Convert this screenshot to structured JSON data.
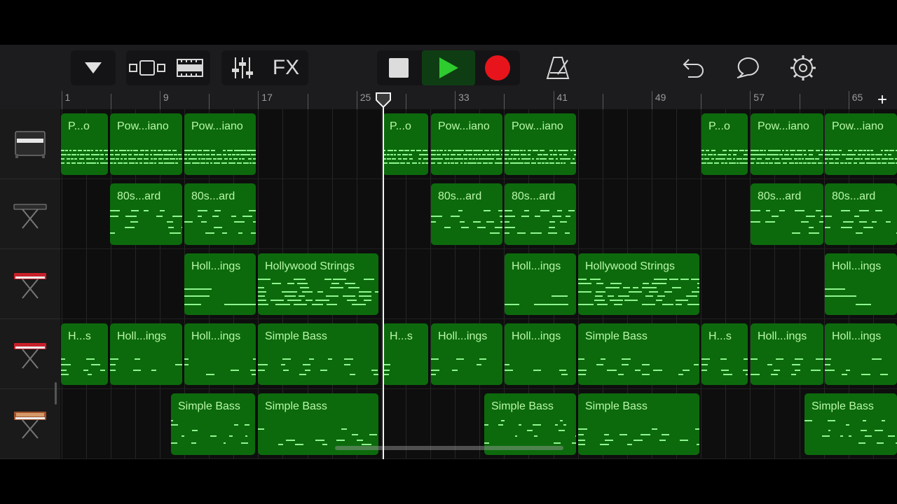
{
  "toolbar": {
    "fx_label": "FX"
  },
  "ruler": {
    "bars": [
      "1",
      "9",
      "17",
      "25",
      "33",
      "41",
      "49",
      "57",
      "65"
    ],
    "add_label": "+"
  },
  "tracks": [
    {
      "instrument": "piano-icon",
      "regions": [
        {
          "name": "P...o",
          "style": "dense"
        },
        {
          "name": "Pow...iano",
          "style": "dense"
        },
        {
          "name": "Pow...iano",
          "style": "dense"
        },
        {
          "name": "P...o",
          "style": "dense"
        },
        {
          "name": "Pow...iano",
          "style": "dense"
        },
        {
          "name": "Pow...iano",
          "style": "dense"
        },
        {
          "name": "P...o",
          "style": "dense"
        },
        {
          "name": "Pow...iano",
          "style": "dense"
        },
        {
          "name": "Pow...iano",
          "style": "dense"
        }
      ]
    },
    {
      "instrument": "keyboard-stand-icon",
      "regions": [
        {
          "name": "80s...ard",
          "style": "keys"
        },
        {
          "name": "80s...ard",
          "style": "keys"
        },
        {
          "name": "80s...ard",
          "style": "keys"
        },
        {
          "name": "80s...ard",
          "style": "keys"
        },
        {
          "name": "80s...ard",
          "style": "keys"
        },
        {
          "name": "80s...ard",
          "style": "keys"
        }
      ]
    },
    {
      "instrument": "red-synth-icon",
      "regions": [
        {
          "name": "Holl...ings",
          "style": "strings-sparse"
        },
        {
          "name": "Hollywood Strings",
          "style": "strings"
        },
        {
          "name": "Holl...ings",
          "style": "strings-sparse"
        },
        {
          "name": "Hollywood Strings",
          "style": "strings"
        },
        {
          "name": "Holl...ings",
          "style": "strings-sparse"
        }
      ]
    },
    {
      "instrument": "red-synth-icon",
      "regions": [
        {
          "name": "H...s",
          "style": "bass"
        },
        {
          "name": "Holl...ings",
          "style": "bass"
        },
        {
          "name": "Holl...ings",
          "style": "bass"
        },
        {
          "name": "Simple Bass",
          "style": "bass"
        },
        {
          "name": "H...s",
          "style": "bass"
        },
        {
          "name": "Holl...ings",
          "style": "bass"
        },
        {
          "name": "Holl...ings",
          "style": "bass"
        },
        {
          "name": "Simple Bass",
          "style": "bass"
        },
        {
          "name": "H...s",
          "style": "bass"
        },
        {
          "name": "Holl...ings",
          "style": "bass"
        },
        {
          "name": "Holl...ings",
          "style": "bass"
        }
      ]
    },
    {
      "instrument": "analog-synth-icon",
      "regions": [
        {
          "name": "Simple Bass",
          "style": "bass2"
        },
        {
          "name": "Simple Bass",
          "style": "bass"
        },
        {
          "name": "Simple Bass",
          "style": "bass2"
        },
        {
          "name": "Simple Bass",
          "style": "bass"
        },
        {
          "name": "Simple Bass",
          "style": "bass2"
        }
      ]
    }
  ],
  "colors": {
    "region_fill": "#0c6a0c",
    "region_text": "#b8f7a8",
    "note": "#8ff68f",
    "record": "#e8141c",
    "play": "#2ecc2e"
  }
}
